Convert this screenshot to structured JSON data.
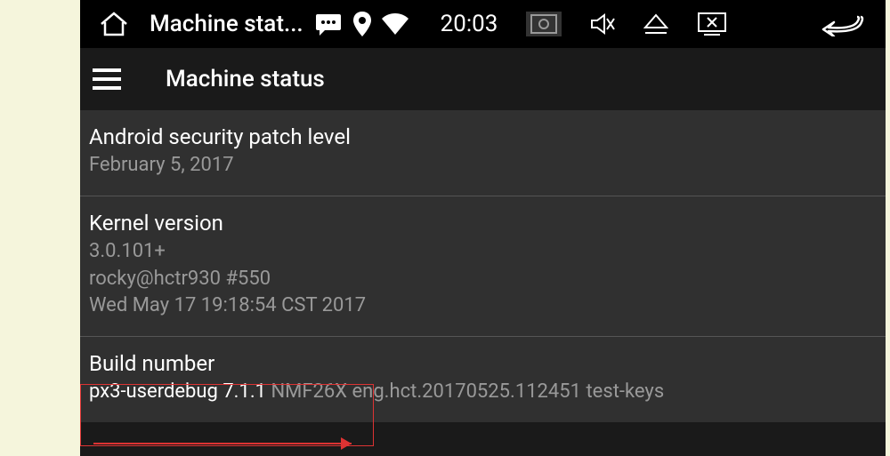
{
  "status_bar": {
    "title": "Machine stat...",
    "clock": "20:03"
  },
  "app": {
    "title": "Machine status"
  },
  "items": {
    "security": {
      "title": "Android security patch level",
      "value": "February 5, 2017"
    },
    "kernel": {
      "title": "Kernel version",
      "value": "3.0.101+\nrocky@hctr930 #550\nWed May 17 19:18:54 CST 2017"
    },
    "build": {
      "title": "Build number",
      "value_hl": "px3-userdebug 7.1.1",
      "value_rest": " NMF26X eng.hct.20170525.112451 test-keys"
    }
  }
}
